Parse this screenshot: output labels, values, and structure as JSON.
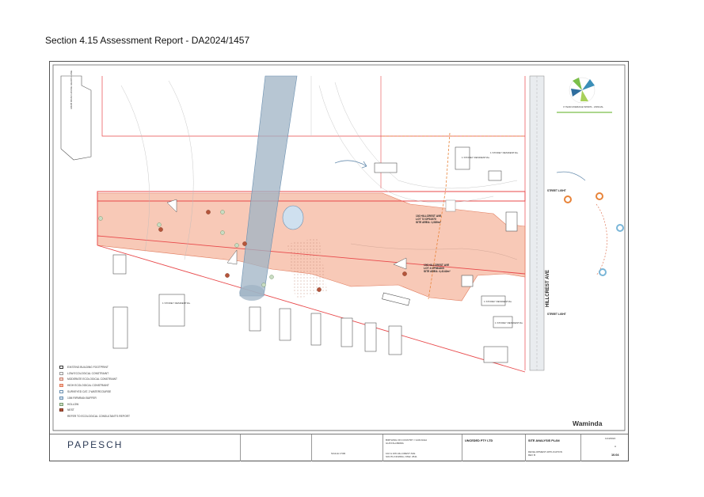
{
  "report_title": "Section 4.15 Assessment Report - DA2024/1457",
  "plan": {
    "street_hillcrest": "HILLCREST AVE",
    "lot_labels": [
      {
        "line1": "102 HILLCREST AVE",
        "line2": "LOT 72 DP31970",
        "line3": "SITE AREA: 1,089m²"
      },
      {
        "line1": "106 HILLCREST AVE",
        "line2": "LOT 4 DP581805",
        "line3": "SITE AREA: 4,4142m²"
      }
    ],
    "winds_caption": "3 YEAR AVERAGE WINDS - ANNUAL",
    "street_light_top": "STREET LIGHT",
    "street_light_bottom": "STREET LIGHT",
    "arab_road_label": "ARAB ROAD HOUSE HEADS LANE",
    "residence_labels": [
      "1 STOREY RESIDENTIAL",
      "1 STOREY RESIDENTIAL",
      "1 STOREY RESIDENTIAL",
      "1 STOREY RESIDENTIAL",
      "1 STOREY RESIDENTIAL"
    ]
  },
  "legend": [
    {
      "label": "EXISTING BUILDING FOOTPRINT",
      "fill": "#ffffff",
      "stroke": "#333333"
    },
    {
      "label": "LOW ECOLOGICAL CONSTRAINT",
      "fill": "#ffffff",
      "stroke": "#999999"
    },
    {
      "label": "MODERATE ECOLOGICAL CONSTRAINT",
      "fill": "#f5d8cc",
      "stroke": "#c87b6a"
    },
    {
      "label": "HIGH ECOLOGICAL CONSTRAINT",
      "fill": "#f6b79f",
      "stroke": "#e07a5c"
    },
    {
      "label": "SURVEYED CAT. 2 WATERCOURSE",
      "fill": "#ffffff",
      "stroke": "#6a8fb0"
    },
    {
      "label": "10M RIPARIAN BUFFER",
      "fill": "#cfe0ef",
      "stroke": "#6a8fb0"
    },
    {
      "label": "HOLLOW",
      "fill": "#c9dcc3",
      "stroke": "#7a9a72"
    },
    {
      "label": "NEST",
      "fill": "#b5553b",
      "stroke": "#7a3320"
    },
    {
      "label": "REFER TO ECOLOGICAL CONSULTANT'S REPORT",
      "fill": "#ffffff",
      "stroke": "#ffffff"
    }
  ],
  "title_block": {
    "firm": "PAPESCH",
    "project_line1": "BIRTHING ON COUNTRY / GUDJAGA",
    "project_line2": "GUNYAH-BIRRA",
    "address_line1": "102 & 106 HILLCREST AVE",
    "address_line2": "SOUTH NOWRA, NSW, 2541",
    "client": "UNCEDED PTY LTD",
    "drawing_title": "SITE ANALYSIS PLAN",
    "status_line1": "DEVELOPMENT APPLICATION",
    "status_line2": "REV B",
    "drawing_no": "10.04",
    "rev": "A",
    "date": "11/4/2024",
    "scale": "SCALE 1:500",
    "waminda": "Waminda"
  },
  "colors": {
    "high_constraint": "#f6b79f",
    "boundary": "#e8484a",
    "riparian": "#9fb3c4",
    "nest": "#b5553b",
    "hollow": "#c9dcc3"
  }
}
